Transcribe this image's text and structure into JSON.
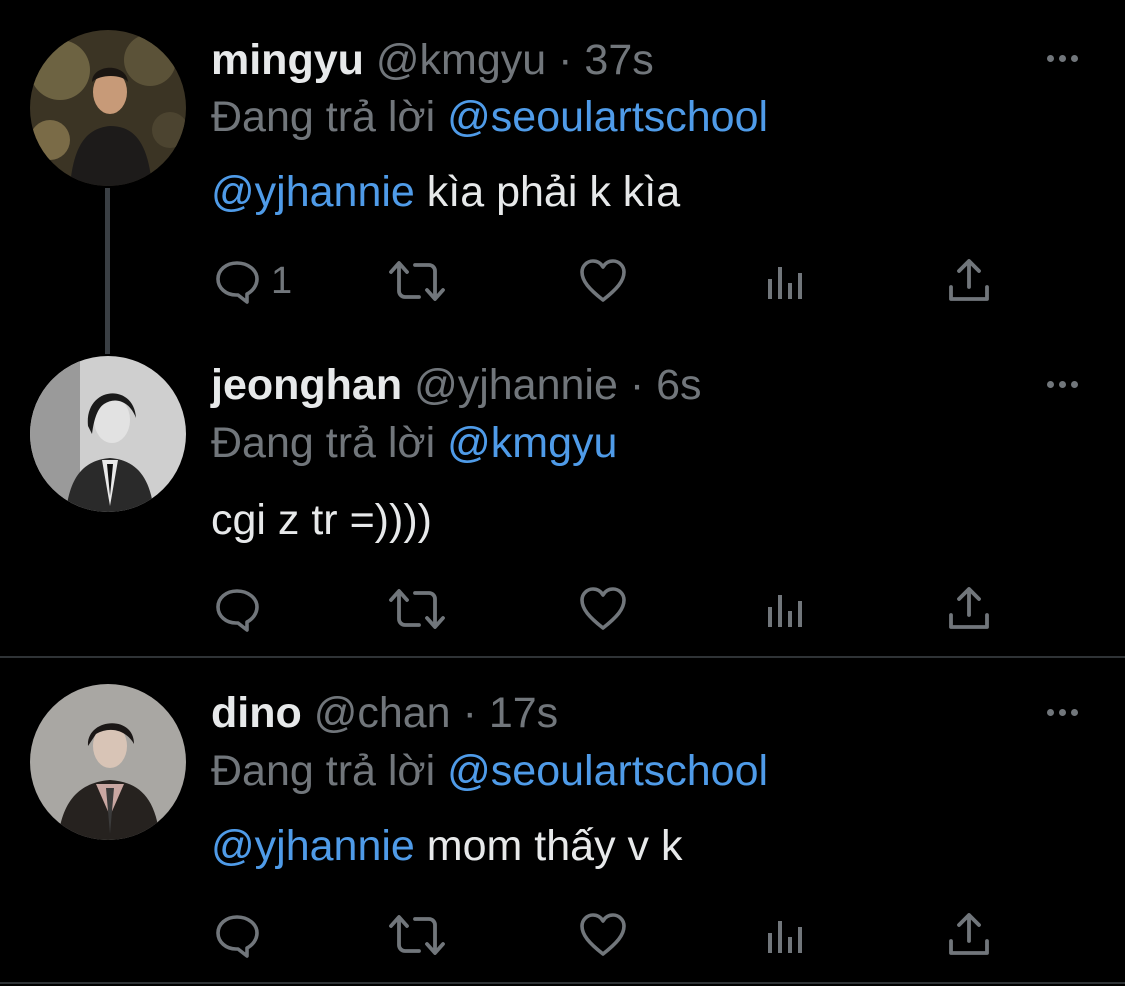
{
  "colors": {
    "background": "#000000",
    "text": "#e7e9ea",
    "muted": "#71767b",
    "link": "#4f9be8",
    "divider": "#2f3336"
  },
  "tweets": [
    {
      "name": "mingyu",
      "handle": "@kmgyu",
      "dot": "·",
      "time": "37s",
      "reply_prefix": "Đang trả lời",
      "reply_to": "@seoulartschool",
      "body_mention": "@yjhannie",
      "body_text": " kìa phải k kìa",
      "reply_count": "1",
      "more_icon": "more-horizontal-icon"
    },
    {
      "name": "jeonghan",
      "handle": "@yjhannie",
      "dot": "·",
      "time": "6s",
      "reply_prefix": "Đang trả lời",
      "reply_to": "@kmgyu",
      "body_mention": "",
      "body_text": "cgi z tr =))))",
      "reply_count": "",
      "more_icon": "more-horizontal-icon"
    },
    {
      "name": "dino",
      "handle": "@chan",
      "dot": "·",
      "time": "17s",
      "reply_prefix": "Đang trả lời",
      "reply_to": "@seoulartschool",
      "body_mention": "@yjhannie",
      "body_text": " mom thấy v k",
      "reply_count": "",
      "more_icon": "more-horizontal-icon"
    }
  ],
  "action_icons": [
    "reply-icon",
    "retweet-icon",
    "like-icon",
    "views-icon",
    "share-icon"
  ]
}
